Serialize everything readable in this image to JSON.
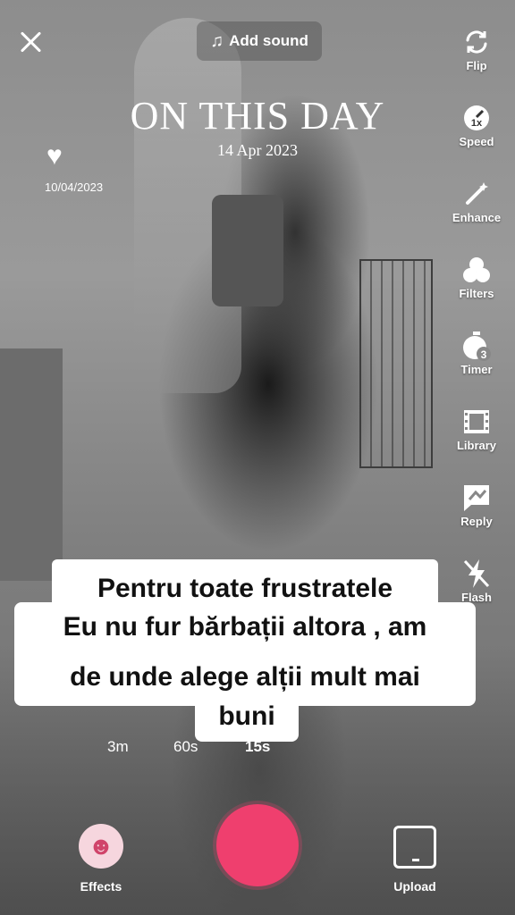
{
  "header": {
    "add_sound_label": "Add sound",
    "close_icon": "close-icon",
    "music_icon": "music-note-icon"
  },
  "overlay": {
    "title": "ON THIS DAY",
    "subtitle": "14 Apr 2023",
    "like_date": "10/04/2023"
  },
  "right_rail": [
    {
      "label": "Flip",
      "icon": "flip-icon"
    },
    {
      "label": "Speed",
      "icon": "speed-icon"
    },
    {
      "label": "Enhance",
      "icon": "enhance-icon"
    },
    {
      "label": "Filters",
      "icon": "filters-icon"
    },
    {
      "label": "Timer",
      "icon": "timer-icon"
    },
    {
      "label": "Library",
      "icon": "library-icon"
    },
    {
      "label": "Reply",
      "icon": "reply-icon"
    },
    {
      "label": "Flash",
      "icon": "flash-icon"
    }
  ],
  "caption": {
    "line1": "Pentru toate frustratele",
    "line2": "Eu nu fur bărbații altora , am",
    "line3": "de unde alege alții mult mai",
    "line4": "buni"
  },
  "durations": {
    "d1": "3m",
    "d2": "60s",
    "d3": "15s",
    "selected": "15s"
  },
  "bottom": {
    "effects_label": "Effects",
    "upload_label": "Upload"
  },
  "colors": {
    "record": "#ef3f6e",
    "caption_bg": "#ffffff"
  }
}
